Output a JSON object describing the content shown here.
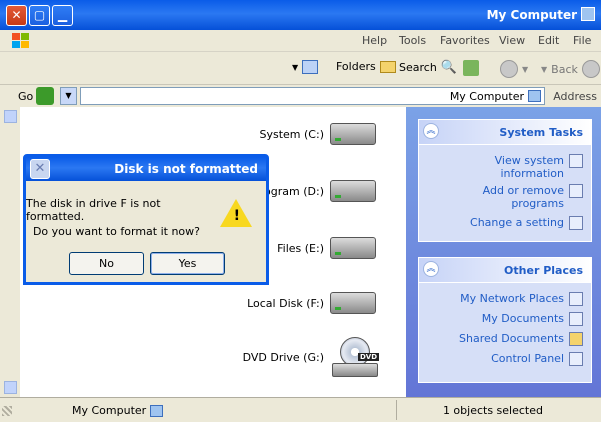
{
  "window": {
    "title": "My Computer",
    "menu": [
      "File",
      "Edit",
      "View",
      "Favorites",
      "Tools",
      "Help"
    ]
  },
  "toolbar": {
    "back_label": "Back",
    "search_label": "Search",
    "folders_label": "Folders"
  },
  "address": {
    "label": "Address",
    "value": "My Computer",
    "go_label": "Go"
  },
  "drives": [
    {
      "name": "System (C:)",
      "type": "hdd"
    },
    {
      "name": "Program (D:)",
      "type": "hdd"
    },
    {
      "name": "Files (E:)",
      "type": "hdd"
    },
    {
      "name": "Local Disk (F:)",
      "type": "hdd"
    },
    {
      "name": "DVD Drive (G:)",
      "type": "dvd"
    }
  ],
  "dvd_badge": "DVD",
  "system_tasks": {
    "title": "System Tasks",
    "items": [
      "View system information",
      "Add or remove programs",
      "Change a setting"
    ]
  },
  "other_places": {
    "title": "Other Places",
    "items": [
      "My Network Places",
      "My Documents",
      "Shared Documents",
      "Control Panel"
    ]
  },
  "status": {
    "objects": "1 objects selected",
    "location": "My Computer"
  },
  "dialog": {
    "title": "Disk is not formatted",
    "message": "The disk in drive F is not formatted.",
    "question": "Do you want to format it now?",
    "yes_label": "Yes",
    "no_label": "No"
  },
  "colors": {
    "titlebar": "#0a5ce8",
    "link": "#215dc6",
    "taskpane": "#6375d6"
  }
}
